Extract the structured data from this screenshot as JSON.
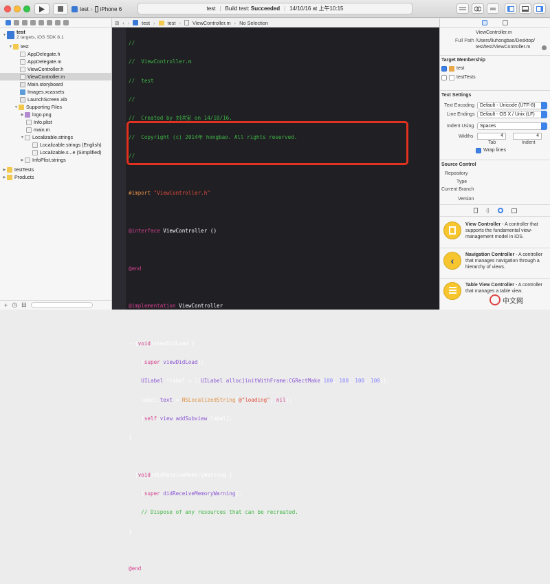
{
  "toolbar": {
    "scheme_target": "test",
    "device": "iPhone 6",
    "status_project": "test",
    "status_build": "Build test:",
    "status_result": "Succeeded",
    "status_time": "14/10/16 at 上午10:15"
  },
  "navigator": {
    "project_name": "test",
    "project_sub": "2 targets, iOS SDK 8.1",
    "items": [
      {
        "label": "test"
      },
      {
        "label": "AppDelegate.h"
      },
      {
        "label": "AppDelegate.m"
      },
      {
        "label": "ViewController.h"
      },
      {
        "label": "ViewController.m"
      },
      {
        "label": "Main.storyboard"
      },
      {
        "label": "Images.xcassets"
      },
      {
        "label": "LaunchScreen.xib"
      },
      {
        "label": "Supporting Files"
      },
      {
        "label": "logo.png"
      },
      {
        "label": "Info.plist"
      },
      {
        "label": "main.m"
      },
      {
        "label": "Localizable.strings"
      },
      {
        "label": "Localizable.strings (English)"
      },
      {
        "label": "Localizable.s...e (Simplified)"
      },
      {
        "label": "InfoPlist.strings"
      },
      {
        "label": "testTests"
      },
      {
        "label": "Products"
      }
    ]
  },
  "editor": {
    "jump_project": "test",
    "jump_folder": "test",
    "jump_file": "ViewController.m",
    "jump_selection": "No Selection",
    "lines": {
      "l1": "//",
      "l2": "//  ViewController.m",
      "l3": "//  test",
      "l4": "//",
      "l5": "//  Created by 刘洪宝 on 14/10/16.",
      "l6": "//  Copyright (c) 2014年 hongbao. All rights reserved.",
      "l7": "//",
      "l9a": "#import ",
      "l9b": "\"ViewController.h\"",
      "l11a": "@interface",
      "l11b": " ViewController ()",
      "l13": "@end",
      "l15a": "@implementation",
      "l15b": " ViewController",
      "l17a": "- (",
      "l17b": "void",
      "l17c": ")viewDidLoad {",
      "l18a": "    [",
      "l18b": "super",
      "l18c": " viewDidLoad",
      "l18d": "];",
      "l19a": "    UILabel",
      "l19b": " *label = [[",
      "l19c": "UILabel",
      "l19d": " alloc]",
      "l19e": "initWithFrame:",
      "l19f": "CGRectMake",
      "l19g": "(",
      "l19h": "100",
      "l19i": ", ",
      "l19j": "100",
      "l19k": ", ",
      "l19l": "100",
      "l19m": ", ",
      "l19n": "100",
      "l19o": ")];",
      "l20a": "    label.",
      "l20b": "text",
      "l20c": " = ",
      "l20d": "NSLocalizedString",
      "l20e": "(",
      "l20f": "@\"loading\"",
      "l20g": ", ",
      "l20h": "nil",
      "l20i": ");",
      "l21a": "    [",
      "l21b": "self",
      "l21c": ".",
      "l21d": "view",
      "l21e": " addSubview",
      "l21f": ":label];",
      "l22": "}",
      "l24a": "- (",
      "l24b": "void",
      "l24c": ")didReceiveMemoryWarning {",
      "l25a": "    [",
      "l25b": "super",
      "l25c": " didReceiveMemoryWarning",
      "l25d": "];",
      "l26": "    // Dispose of any resources that can be recreated.",
      "l27": "}",
      "l29": "@end"
    }
  },
  "utilities": {
    "file_name": "ViewController.m",
    "full_path_label": "Full Path",
    "full_path_1": "/Users/liuhongbao/Desktop/",
    "full_path_2": "test/test/ViewController.m",
    "target_membership_title": "Target Membership",
    "target_1": "test",
    "target_2": "testTests",
    "text_settings_title": "Text Settings",
    "text_encoding_label": "Text Encoding",
    "text_encoding_value": "Default - Unicode (UTF-8)",
    "line_endings_label": "Line Endings",
    "line_endings_value": "Default - OS X / Unix (LF)",
    "indent_using_label": "Indent Using",
    "indent_using_value": "Spaces",
    "widths_label": "Widths",
    "tab_value": "4",
    "indent_value": "4",
    "tab_label": "Tab",
    "indent_label": "Indent",
    "wrap_lines_label": "Wrap lines",
    "source_control_title": "Source Control",
    "repository_label": "Repository",
    "type_label": "Type",
    "current_branch_label": "Current Branch",
    "version_label": "Version",
    "library": [
      {
        "title": "View Controller",
        "desc": " - A controller that supports the fundamental view-management model in iOS."
      },
      {
        "title": "Navigation Controller",
        "desc": " - A controller that manages navigation through a hierarchy of views."
      },
      {
        "title": "Table View Controller",
        "desc": " - A controller that manages a table view."
      }
    ]
  },
  "watermark": {
    "text": "中文网"
  },
  "colors": {
    "editor_bg": "#1f1f24",
    "comment": "#41b645",
    "keyword": "#d4418e",
    "string": "#e04c3a",
    "highlight_border": "#e2321f",
    "accent": "#3d82e8"
  }
}
